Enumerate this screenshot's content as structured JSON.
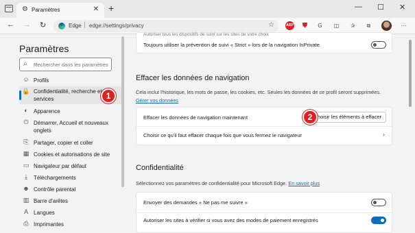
{
  "tab": {
    "title": "Paramètres"
  },
  "addressbar": {
    "site_label": "Edge",
    "url": "edge://settings/privacy"
  },
  "sidebar": {
    "title": "Paramètres",
    "search_placeholder": "Rechercher dans les paramètres",
    "items": [
      {
        "label": "Profils",
        "icon": "person-icon"
      },
      {
        "label": "Confidentialité, recherche et services",
        "icon": "lock-icon",
        "active": true
      },
      {
        "label": "Apparence",
        "icon": "palette-icon"
      },
      {
        "label": "Démarrer, Accueil et nouveaux onglets",
        "icon": "power-icon"
      },
      {
        "label": "Partager, copier et coller",
        "icon": "share-icon"
      },
      {
        "label": "Cookies et autorisations de site",
        "icon": "cookie-icon"
      },
      {
        "label": "Navigateur par défaut",
        "icon": "browser-icon"
      },
      {
        "label": "Téléchargements",
        "icon": "download-icon"
      },
      {
        "label": "Contrôle parental",
        "icon": "family-icon"
      },
      {
        "label": "Barre d'arêtes",
        "icon": "sidebar-icon"
      },
      {
        "label": "Langues",
        "icon": "language-icon"
      },
      {
        "label": "Imprimantes",
        "icon": "printer-icon"
      }
    ]
  },
  "main": {
    "top_card": {
      "faded_text": "Autoriser tous les dispositifs de suivi sur les sites de votre choix",
      "strict_label": "Toujours utiliser la prévention de suivi « Strict » lors de la navigation InPrivate",
      "strict_on": false
    },
    "clear_section": {
      "title": "Effacer les données de navigation",
      "description": "Cela inclut l'historique, les mots de passe, les cookies, etc. Seules les données de ce profil seront supprimées.",
      "manage_link": "Gérer vos données",
      "clear_now_label": "Effacer les données de navigation maintenant",
      "choose_button": "Choisir les éléments à effacer",
      "on_close_label": "Choisir ce qu'il faut effacer chaque fois que vous fermez le navigateur"
    },
    "privacy_section": {
      "title": "Confidentialité",
      "description": "Sélectionnez vos paramètres de confidentialité pour Microsoft Edge.",
      "learn_more": "En savoir plus",
      "dnt_label": "Envoyer des demandes « Ne pas me suivre »",
      "dnt_on": false,
      "payment_label": "Autoriser les sites à vérifier si vous avez des modes de paiement enregistrés",
      "payment_on": true
    }
  },
  "markers": {
    "one": "1",
    "two": "2"
  },
  "colors": {
    "accent": "#0f6cbd",
    "marker": "#e02020"
  }
}
